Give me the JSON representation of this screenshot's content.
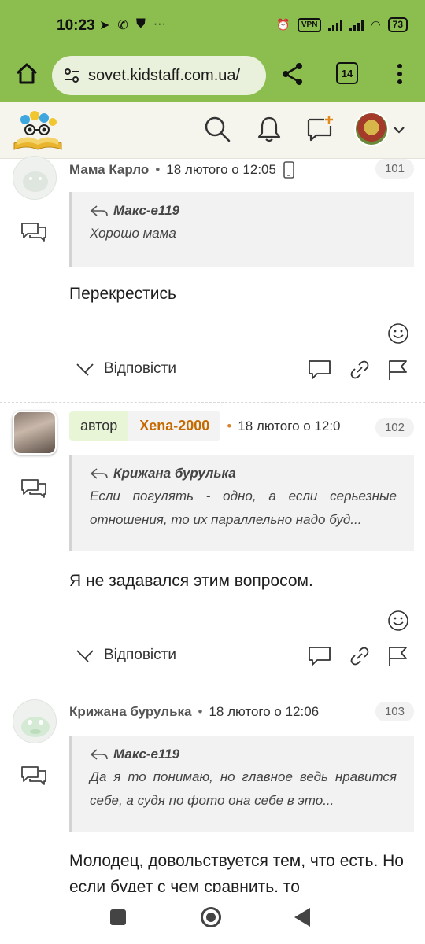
{
  "status_bar": {
    "time": "10:23",
    "left_icons": [
      "telegram-icon",
      "whatsapp-icon",
      "shield-icon",
      "more-dots-icon"
    ],
    "vpn_label": "VPN",
    "battery": "73"
  },
  "browser": {
    "url": "sovet.kidstaff.com.ua/",
    "tab_count": "14"
  },
  "posts": [
    {
      "author": "Мама Карло",
      "date": "18 лютого о 12:05",
      "number": "101",
      "quote_author": "Макс-e119",
      "quote_text": "Хорошо мама",
      "body": "Перекрестись",
      "reply_label": "Відповісти"
    },
    {
      "badge_author": "автор",
      "author": "Xena-2000",
      "date": "18 лютого о 12:0",
      "number": "102",
      "quote_author": "Крижана бурулька",
      "quote_text": "Если погулять - одно, а если серьезные отношения, то их параллельно надо буд...",
      "body": "Я не задавался этим вопросом.",
      "reply_label": "Відповісти"
    },
    {
      "author": "Крижана бурулька",
      "date": "18 лютого о 12:06",
      "number": "103",
      "quote_author": "Макс-e119",
      "quote_text": "Да я то понимаю, но главное ведь нравится себе, а судя по фото она себе в это...",
      "body": "Молодец, довольствуется тем, что есть. Но если будет с чем сравнить, то"
    }
  ]
}
